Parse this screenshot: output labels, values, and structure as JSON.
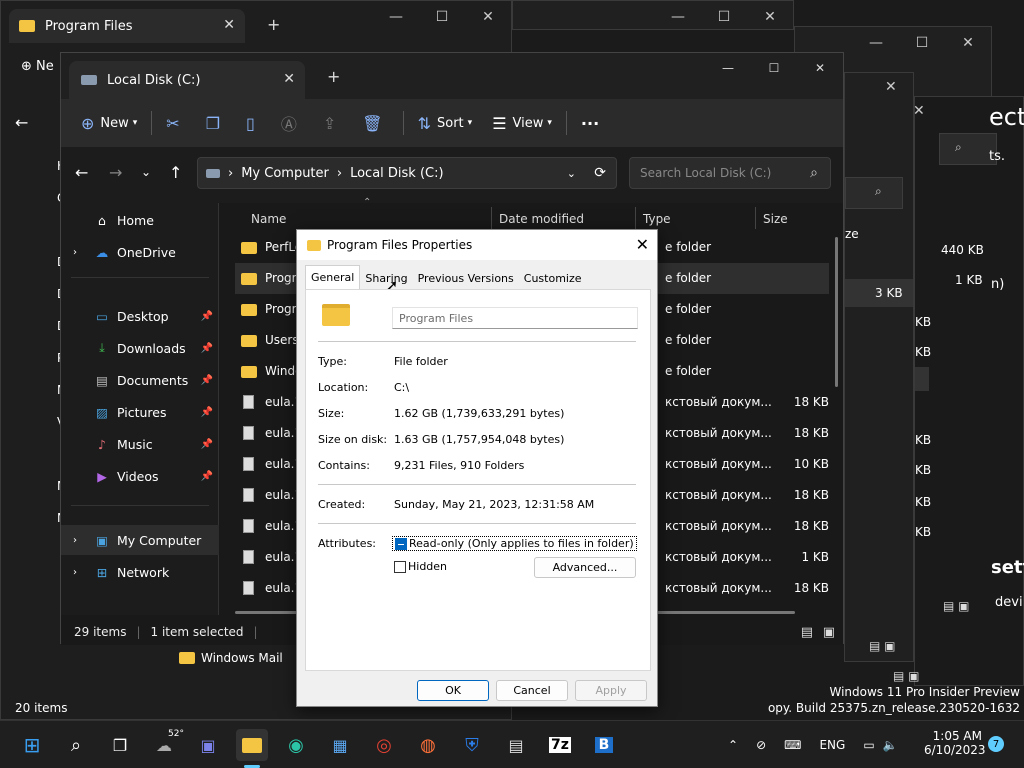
{
  "background_windows": {
    "win1_title": "Program Files",
    "win1_new": "Ne",
    "win1_nav": [
      "H",
      "C",
      "D",
      "D",
      "D",
      "P",
      "M",
      "V",
      "M",
      "N"
    ],
    "win1_folder": "Windows Mail",
    "win1_status": "20 items",
    "right_sizes": [
      "440 KB",
      "1 KB",
      "3 KB",
      "KB",
      "KB",
      "KB",
      "KB",
      "KB",
      "KB"
    ],
    "right_edge_text": [
      "ect",
      "ts.",
      "n)",
      "sett",
      "devi"
    ],
    "right_ze": "ze"
  },
  "explorer": {
    "tab_title": "Local Disk (C:)",
    "toolbar": {
      "new": "New",
      "sort": "Sort",
      "view": "View",
      "more": "···"
    },
    "breadcrumb": [
      "My Computer",
      "Local Disk (C:)"
    ],
    "search_placeholder": "Search Local Disk (C:)",
    "nav": {
      "home": "Home",
      "onedrive": "OneDrive",
      "desktop": "Desktop",
      "downloads": "Downloads",
      "documents": "Documents",
      "pictures": "Pictures",
      "music": "Music",
      "videos": "Videos",
      "mycomputer": "My Computer",
      "network": "Network"
    },
    "columns": {
      "name": "Name",
      "date": "Date modified",
      "type": "Type",
      "size": "Size"
    },
    "rows": [
      {
        "name": "PerfLog",
        "type": "e folder",
        "size": ""
      },
      {
        "name": "Progra",
        "type": "e folder",
        "size": ""
      },
      {
        "name": "Progra",
        "type": "e folder",
        "size": ""
      },
      {
        "name": "Users",
        "type": "e folder",
        "size": ""
      },
      {
        "name": "Windo",
        "type": "e folder",
        "size": ""
      },
      {
        "name": "eula.10",
        "type": "кстовый докум...",
        "size": "18 KB"
      },
      {
        "name": "eula.10",
        "type": "кстовый докум...",
        "size": "18 KB"
      },
      {
        "name": "eula.10",
        "type": "кстовый докум...",
        "size": "10 KB"
      },
      {
        "name": "eula.10",
        "type": "кстовый докум...",
        "size": "18 KB"
      },
      {
        "name": "eula.10",
        "type": "кстовый докум...",
        "size": "18 KB"
      },
      {
        "name": "eula.10",
        "type": "кстовый докум...",
        "size": "1 KB"
      },
      {
        "name": "eula.10",
        "type": "кстовый докум...",
        "size": "18 KB"
      }
    ],
    "status_items": "29 items",
    "status_selected": "1 item selected"
  },
  "dialog": {
    "title": "Program Files Properties",
    "tabs": [
      "General",
      "Sharing",
      "Previous Versions",
      "Customize"
    ],
    "name_value": "Program Files",
    "type_label": "Type:",
    "type_value": "File folder",
    "location_label": "Location:",
    "location_value": "C:\\",
    "size_label": "Size:",
    "size_value": "1.62 GB (1,739,633,291 bytes)",
    "sizeondisk_label": "Size on disk:",
    "sizeondisk_value": "1.63 GB (1,757,954,048 bytes)",
    "contains_label": "Contains:",
    "contains_value": "9,231 Files, 910 Folders",
    "created_label": "Created:",
    "created_value": "Sunday, May 21, 2023, 12:31:58 AM",
    "attributes_label": "Attributes:",
    "readonly_label": "Read-only (Only applies to files in folder)",
    "hidden_label": "Hidden",
    "advanced_button": "Advanced...",
    "ok_button": "OK",
    "cancel_button": "Cancel",
    "apply_button": "Apply"
  },
  "watermark": {
    "line1": "Windows 11 Pro Insider Preview",
    "line2": "opy. Build 25375.zn_release.230520-1632"
  },
  "taskbar": {
    "weather_temp": "52°",
    "lang": "ENG",
    "time": "1:05 AM",
    "date": "6/10/2023",
    "notif_count": "7",
    "app_7z": "7z",
    "app_b": "B"
  },
  "colors": {
    "accent": "#0067c0",
    "folder": "#f4c542",
    "dark_bg": "#191919"
  }
}
